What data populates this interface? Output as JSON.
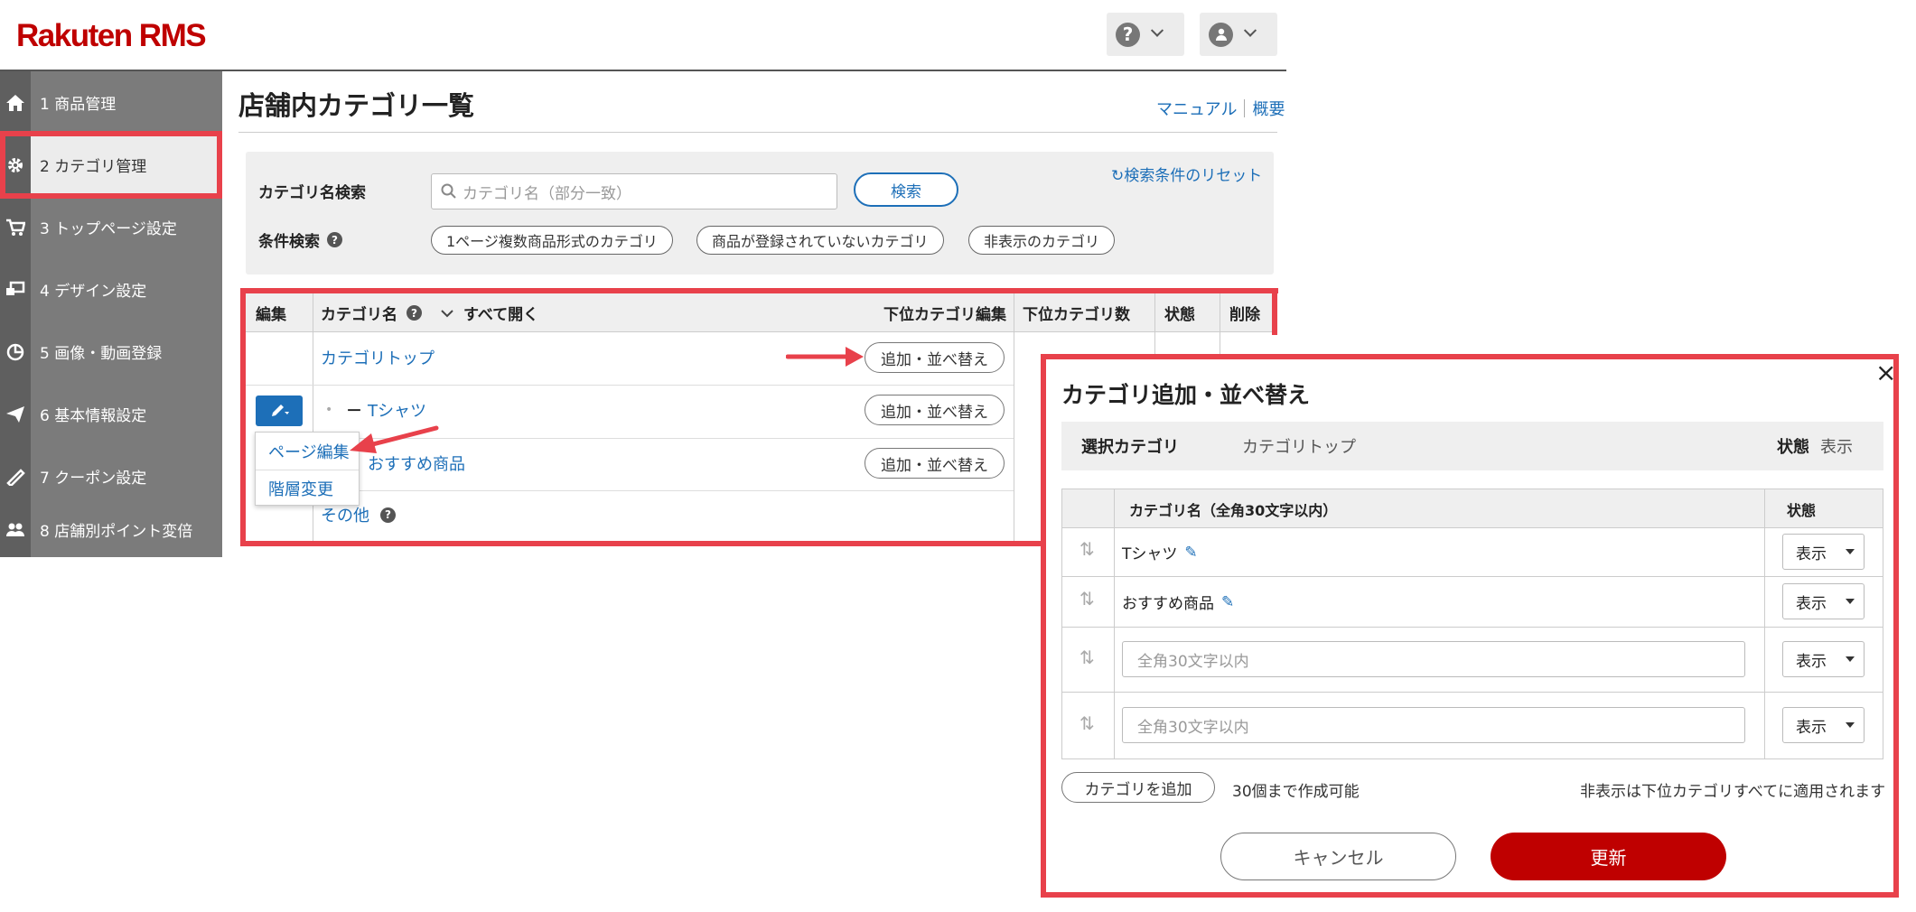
{
  "header": {
    "logo": "Rakuten RMS",
    "help_icon_label": "?"
  },
  "sidebar": {
    "items": [
      {
        "label": "1 商品管理"
      },
      {
        "label": "2 カテゴリ管理"
      },
      {
        "label": "3 トップページ設定"
      },
      {
        "label": "4 デザイン設定"
      },
      {
        "label": "5 画像・動画登録"
      },
      {
        "label": "6 基本情報設定"
      },
      {
        "label": "7 クーポン設定"
      },
      {
        "label": "8 店舗別ポイント変倍"
      }
    ]
  },
  "page": {
    "title": "店舗内カテゴリ一覧",
    "manual_link": "マニュアル",
    "overview_link": "概要"
  },
  "search": {
    "label": "カテゴリ名検索",
    "placeholder": "カテゴリ名（部分一致）",
    "button": "検索",
    "reset": "検索条件のリセット",
    "filter_label": "条件検索",
    "filters": [
      "1ページ複数商品形式のカテゴリ",
      "商品が登録されていないカテゴリ",
      "非表示のカテゴリ"
    ]
  },
  "table": {
    "headers": {
      "edit": "編集",
      "name": "カテゴリ名",
      "expand": "すべて開く",
      "sub_edit": "下位カテゴリ編集",
      "sub_count": "下位カテゴリ数",
      "status": "状態",
      "delete": "削除"
    },
    "rows": [
      {
        "name": "カテゴリトップ",
        "action": "追加・並べ替え"
      },
      {
        "name": "Tシャツ",
        "action": "追加・並べ替え",
        "prefix": "－"
      },
      {
        "name": "おすすめ商品",
        "action": "追加・並べ替え"
      },
      {
        "name": "その他"
      }
    ],
    "dropdown": [
      "ページ編集",
      "階層変更"
    ]
  },
  "modal": {
    "title": "カテゴリ追加・並べ替え",
    "selected_label": "選択カテゴリ",
    "selected_value": "カテゴリトップ",
    "status_label": "状態",
    "status_value": "表示",
    "col_name": "カテゴリ名（全角30文字以内）",
    "col_status": "状態",
    "rows": [
      {
        "name": "Tシャツ",
        "status": "表示"
      },
      {
        "name": "おすすめ商品",
        "status": "表示"
      },
      {
        "placeholder": "全角30文字以内",
        "status": "表示"
      },
      {
        "placeholder": "全角30文字以内",
        "status": "表示"
      }
    ],
    "add_button": "カテゴリを追加",
    "limit_note": "30個まで作成可能",
    "hidden_note": "非表示は下位カテゴリすべてに適用されます",
    "cancel": "キャンセル",
    "update": "更新",
    "close": "×"
  },
  "colors": {
    "brand": "#bf0000",
    "link": "#1d6fb8",
    "highlight": "#e8414b"
  }
}
